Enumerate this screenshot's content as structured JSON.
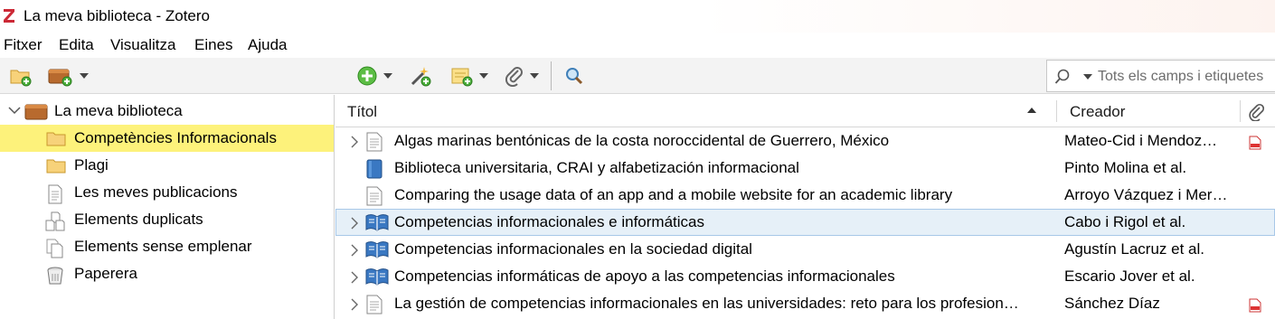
{
  "window": {
    "title": "La meva biblioteca - Zotero",
    "app_icon": "zotero-z-icon"
  },
  "menu": {
    "items": [
      {
        "label": "Fitxer"
      },
      {
        "label": "Edita"
      },
      {
        "label": "Visualitza"
      },
      {
        "label": "Eines"
      },
      {
        "label": "Ajuda"
      }
    ]
  },
  "toolbar": {
    "buttons": [
      {
        "icon": "new-collection-icon"
      },
      {
        "icon": "new-library-icon",
        "has_dropdown": true
      },
      {
        "icon": "new-item-icon",
        "has_dropdown": true
      },
      {
        "icon": "add-by-identifier-icon"
      },
      {
        "icon": "new-note-icon",
        "has_dropdown": true
      },
      {
        "icon": "add-attachment-icon",
        "has_dropdown": true
      },
      {
        "icon": "advanced-search-icon"
      }
    ],
    "search": {
      "placeholder": "Tots els camps i etiquetes",
      "value": ""
    }
  },
  "collections": {
    "library": {
      "label": "La meva biblioteca",
      "expanded": true
    },
    "items": [
      {
        "label": "Competències Informacionals",
        "icon": "folder-icon",
        "selected": true
      },
      {
        "label": "Plagi",
        "icon": "folder-icon",
        "selected": false
      },
      {
        "label": "Les meves publicacions",
        "icon": "document-icon",
        "selected": false
      },
      {
        "label": "Elements duplicats",
        "icon": "duplicate-items-icon",
        "selected": false
      },
      {
        "label": "Elements sense emplenar",
        "icon": "unfiled-items-icon",
        "selected": false
      },
      {
        "label": "Paperera",
        "icon": "trash-icon",
        "selected": false
      }
    ]
  },
  "items_table": {
    "columns": {
      "title": "Títol",
      "creator": "Creador",
      "attachments_icon": "paperclip-icon"
    },
    "sort": "ascending",
    "rows": [
      {
        "title": "Algas marinas bentónicas de la costa noroccidental de Guerrero, México",
        "creator": "Mateo-Cid i Mendoz…",
        "type": "journal-article-icon",
        "expandable": true,
        "attachment": "pdf-icon",
        "selected": false
      },
      {
        "title": "Biblioteca universitaria, CRAI y alfabetización informacional",
        "creator": "Pinto Molina et al.",
        "type": "book-icon",
        "expandable": false,
        "attachment": "",
        "selected": false
      },
      {
        "title": "Comparing the usage data of an app and a mobile website for an academic library",
        "creator": "Arroyo Vázquez i Mer…",
        "type": "journal-article-icon",
        "expandable": false,
        "attachment": "",
        "selected": false
      },
      {
        "title": "Competencias informacionales e informáticas",
        "creator": "Cabo i Rigol et al.",
        "type": "book-section-icon",
        "expandable": true,
        "attachment": "",
        "selected": true
      },
      {
        "title": "Competencias informacionales en la sociedad digital",
        "creator": "Agustín Lacruz et al.",
        "type": "book-section-icon",
        "expandable": true,
        "attachment": "",
        "selected": false
      },
      {
        "title": "Competencias informáticas de apoyo a las competencias informacionales",
        "creator": "Escario Jover et al.",
        "type": "book-section-icon",
        "expandable": true,
        "attachment": "",
        "selected": false
      },
      {
        "title": "La gestión de competencias informacionales en las universidades: reto para los profesion…",
        "creator": "Sánchez Díaz",
        "type": "journal-article-icon",
        "expandable": true,
        "attachment": "pdf-icon",
        "selected": false
      }
    ]
  },
  "colors": {
    "selected_collection": "#fdf27b",
    "selected_item": "#e6f0f8",
    "toolbar_bg": "#f3f3f3",
    "brand_red": "#cc2936"
  }
}
